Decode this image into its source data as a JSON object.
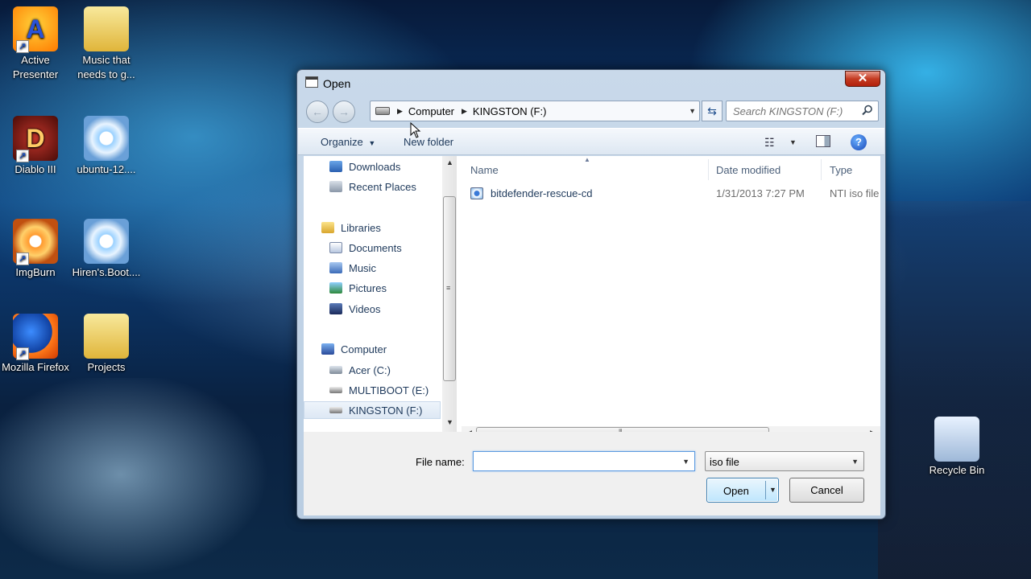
{
  "desktop": {
    "icons": [
      {
        "label": "Active Presenter",
        "icon": "active-presenter-icon"
      },
      {
        "label": "Music that needs to g...",
        "icon": "folder-icon"
      },
      {
        "label": "Diablo III",
        "icon": "diablo-icon"
      },
      {
        "label": "ubuntu-12....",
        "icon": "disc-image-icon"
      },
      {
        "label": "ImgBurn",
        "icon": "imgburn-icon"
      },
      {
        "label": "Hiren's.Boot....",
        "icon": "disc-image-icon"
      },
      {
        "label": "Mozilla Firefox",
        "icon": "firefox-icon"
      },
      {
        "label": "Projects",
        "icon": "folder-icon"
      },
      {
        "label": "Recycle Bin",
        "icon": "recycle-bin-icon"
      }
    ]
  },
  "dialog": {
    "title": "Open",
    "close_label": "✕",
    "address": {
      "segments": [
        "Computer",
        "KINGSTON (F:)"
      ]
    },
    "search": {
      "placeholder": "Search KINGSTON (F:)"
    },
    "toolbar": {
      "organize": "Organize",
      "new_folder": "New folder"
    },
    "nav_pane": {
      "items": [
        {
          "label": "Downloads",
          "icon": "downloads-icon"
        },
        {
          "label": "Recent Places",
          "icon": "recent-places-icon"
        },
        {
          "label": "Libraries",
          "icon": "libraries-icon"
        },
        {
          "label": "Documents",
          "icon": "documents-icon"
        },
        {
          "label": "Music",
          "icon": "music-icon"
        },
        {
          "label": "Pictures",
          "icon": "pictures-icon"
        },
        {
          "label": "Videos",
          "icon": "videos-icon"
        },
        {
          "label": "Computer",
          "icon": "computer-icon"
        },
        {
          "label": "Acer (C:)",
          "icon": "hard-drive-icon"
        },
        {
          "label": "MULTIBOOT (E:)",
          "icon": "usb-drive-icon"
        },
        {
          "label": "KINGSTON (F:)",
          "icon": "usb-drive-icon",
          "selected": true
        }
      ]
    },
    "file_list": {
      "columns": [
        "Name",
        "Date modified",
        "Type"
      ],
      "rows": [
        {
          "name": "bitdefender-rescue-cd",
          "date": "1/31/2013 7:27 PM",
          "type": "NTI iso file"
        }
      ]
    },
    "bottom": {
      "file_name_label": "File name:",
      "file_name_value": "",
      "file_type": "iso file",
      "open_label": "Open",
      "cancel_label": "Cancel"
    }
  }
}
